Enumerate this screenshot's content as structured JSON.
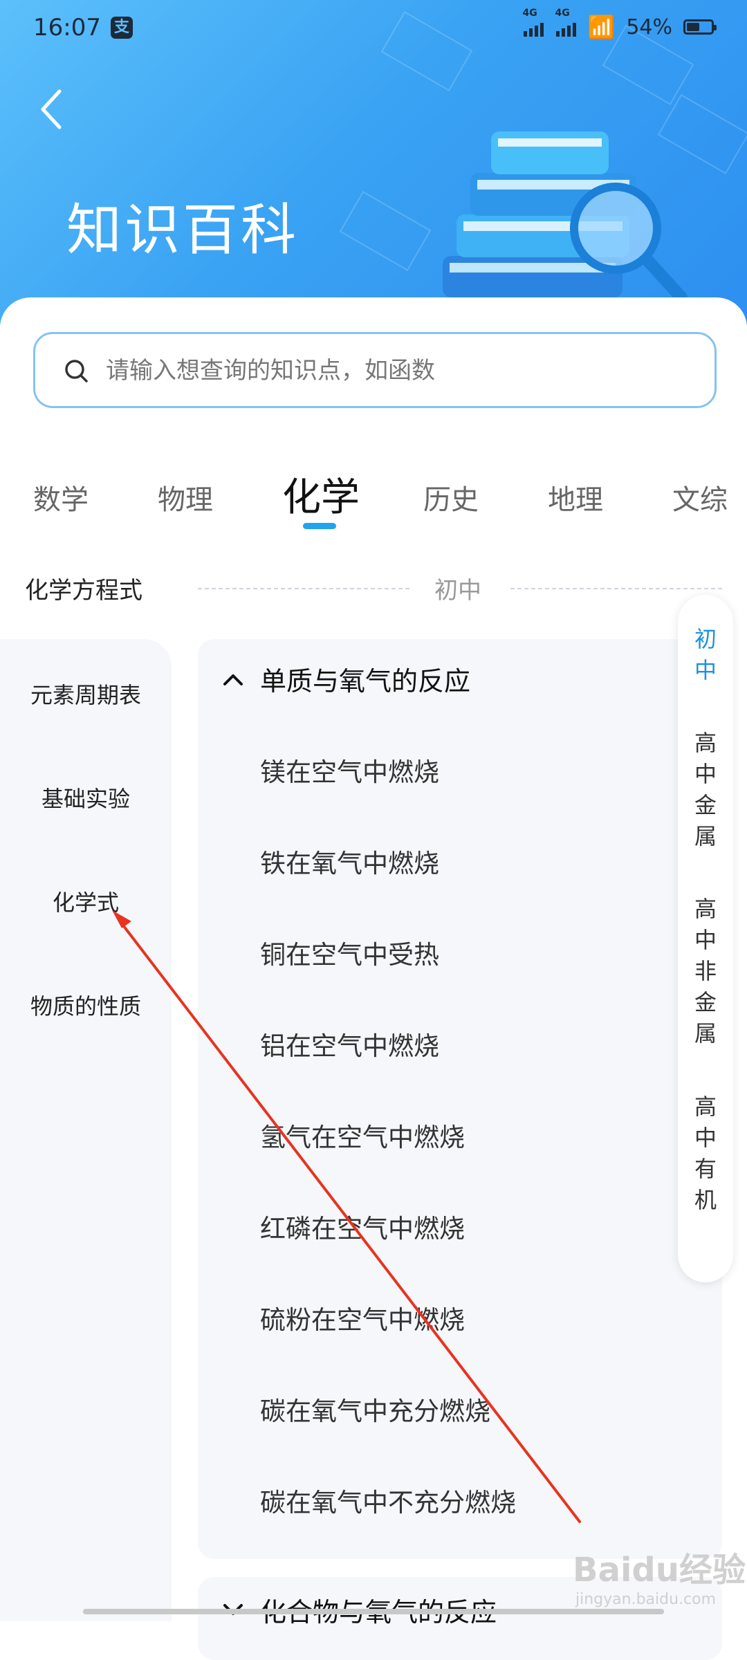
{
  "status": {
    "time": "16:07",
    "network1": "4G",
    "network2": "4G",
    "battery_text": "54%",
    "battery_level": 0.54
  },
  "header": {
    "title": "知识百科"
  },
  "search": {
    "placeholder": "请输入想查询的知识点，如函数"
  },
  "tabs": [
    {
      "label": "数学",
      "active": false
    },
    {
      "label": "物理",
      "active": false
    },
    {
      "label": "化学",
      "active": true
    },
    {
      "label": "历史",
      "active": false
    },
    {
      "label": "地理",
      "active": false
    },
    {
      "label": "文综",
      "active": false
    }
  ],
  "section": {
    "title": "化学方程式",
    "level": "初中"
  },
  "left_nav": [
    {
      "label": "元素周期表"
    },
    {
      "label": "基础实验"
    },
    {
      "label": "化学式"
    },
    {
      "label": "物质的性质"
    }
  ],
  "groups": [
    {
      "title": "单质与氧气的反应",
      "expanded": true,
      "items": [
        "镁在空气中燃烧",
        "铁在氧气中燃烧",
        "铜在空气中受热",
        "铝在空气中燃烧",
        "氢气在空气中燃烧",
        "红磷在空气中燃烧",
        "硫粉在空气中燃烧",
        "碳在氧气中充分燃烧",
        "碳在氧气中不充分燃烧"
      ]
    },
    {
      "title": "化合物与氧气的反应",
      "expanded": false
    }
  ],
  "right_nav": [
    {
      "label": "初中",
      "chars": [
        "初",
        "中"
      ],
      "active": true
    },
    {
      "label": "高中金属",
      "chars": [
        "高",
        "中",
        "金",
        "属"
      ],
      "active": false
    },
    {
      "label": "高中非金属",
      "chars": [
        "高",
        "中",
        "非",
        "金",
        "属"
      ],
      "active": false
    },
    {
      "label": "高中有机",
      "chars": [
        "高",
        "中",
        "有",
        "机"
      ],
      "active": false
    }
  ],
  "watermark": {
    "text": "Baidu经验",
    "sub": "jingyan.baidu.com"
  },
  "colors": {
    "accent": "#22a3ee",
    "header_blue": "#3aa3f3",
    "annotation_arrow": "#e8331f"
  },
  "icons": {
    "back": "chevron-left-icon",
    "search": "search-icon",
    "expanded": "chevron-up-icon",
    "collapsed": "chevron-down-icon"
  }
}
